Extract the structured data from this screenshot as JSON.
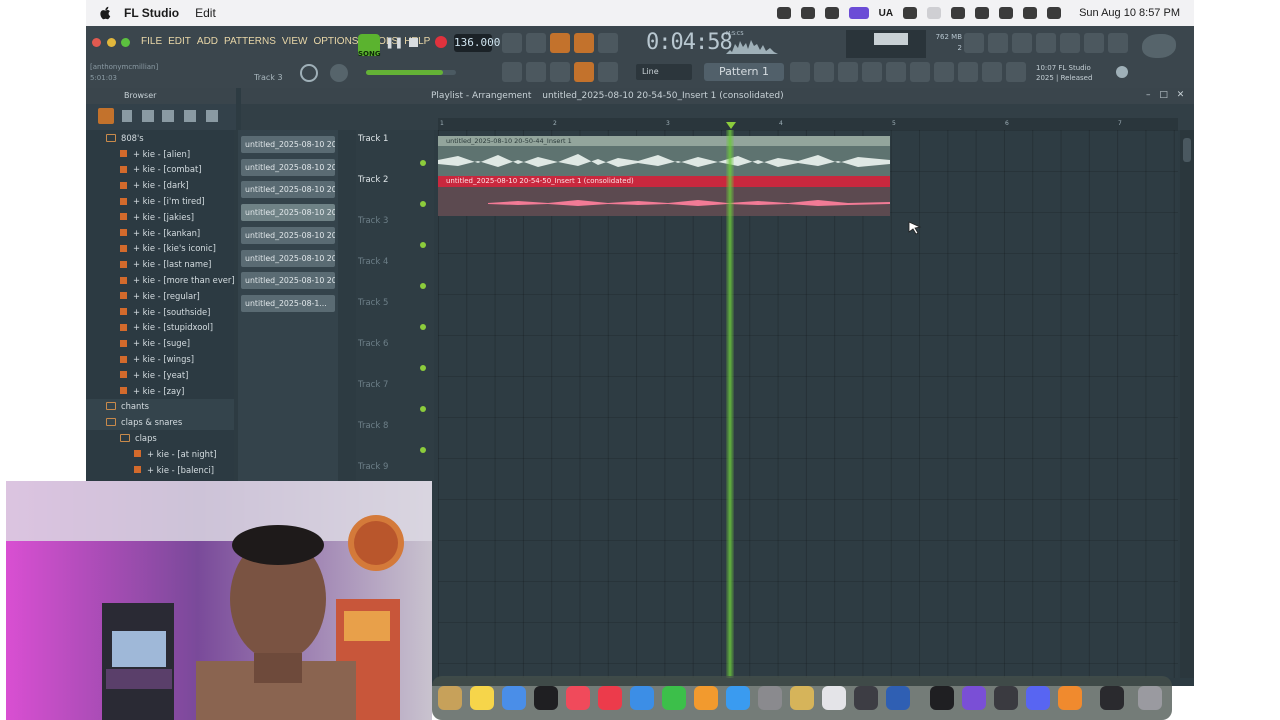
{
  "menubar": {
    "app_name": "FL Studio",
    "menu_edit": "Edit",
    "ua": "UA",
    "clock": "Sun Aug 10  8:57 PM"
  },
  "fl": {
    "menus": [
      "FILE",
      "EDIT",
      "ADD",
      "PATTERNS",
      "VIEW",
      "OPTIONS",
      "TOOLS",
      "HELP"
    ],
    "song_label": "SONG",
    "tempo": "136.000",
    "time": "0:04:58",
    "time_label": "M:S:CS",
    "memory": "762 MB",
    "memory_sub": "2",
    "hint_user": "[anthonymcmillian]",
    "hint_time": "5:01:03",
    "hint_track": "Track 3",
    "snap": "Line",
    "pattern": "Pattern 1",
    "release_line1": "10:07  FL Studio",
    "release_line2": "2025 | Released",
    "master_volume": 0.86
  },
  "browser": {
    "title": "Browser",
    "items": [
      {
        "label": "808's",
        "type": "folder",
        "indent": 1
      },
      {
        "label": "+ kie - [alien]",
        "type": "file",
        "indent": 2
      },
      {
        "label": "+ kie - [combat]",
        "type": "file",
        "indent": 2
      },
      {
        "label": "+ kie - [dark]",
        "type": "file",
        "indent": 2
      },
      {
        "label": "+ kie - [i'm tired]",
        "type": "file",
        "indent": 2
      },
      {
        "label": "+ kie - [jakies]",
        "type": "file",
        "indent": 2
      },
      {
        "label": "+ kie - [kankan]",
        "type": "file",
        "indent": 2
      },
      {
        "label": "+ kie - [kie's iconic]",
        "type": "file",
        "indent": 2
      },
      {
        "label": "+ kie - [last name]",
        "type": "file",
        "indent": 2
      },
      {
        "label": "+ kie - [more than ever]",
        "type": "file",
        "indent": 2
      },
      {
        "label": "+ kie - [regular]",
        "type": "file",
        "indent": 2
      },
      {
        "label": "+ kie - [southside]",
        "type": "file",
        "indent": 2
      },
      {
        "label": "+ kie - [stupidxool]",
        "type": "file",
        "indent": 2
      },
      {
        "label": "+ kie - [suge]",
        "type": "file",
        "indent": 2
      },
      {
        "label": "+ kie - [wings]",
        "type": "file",
        "indent": 2
      },
      {
        "label": "+ kie - [yeat]",
        "type": "file",
        "indent": 2
      },
      {
        "label": "+ kie - [zay]",
        "type": "file",
        "indent": 2
      },
      {
        "label": "chants",
        "type": "folder",
        "indent": 1
      },
      {
        "label": "claps & snares",
        "type": "folder",
        "indent": 1
      },
      {
        "label": "claps",
        "type": "folder",
        "indent": 2
      },
      {
        "label": "+ kie - [at night]",
        "type": "file",
        "indent": 3
      },
      {
        "label": "+ kie - [balenci]",
        "type": "file",
        "indent": 3
      }
    ]
  },
  "picker": {
    "items": [
      "untitled_2025-08-10 20...",
      "untitled_2025-08-10 20...",
      "untitled_2025-08-10 20...",
      "untitled_2025-08-10 20...",
      "untitled_2025-08-10 20...",
      "untitled_2025-08-10 20...",
      "untitled_2025-08-10 20...",
      "untitled_2025-08-1..."
    ]
  },
  "playlist": {
    "title": "Playlist - Arrangement",
    "breadcrumb": "untitled_2025-08-10 20-54-50_Insert 1 (consolidated)",
    "ruler": [
      "1",
      "2",
      "3",
      "4",
      "5",
      "6",
      "7"
    ],
    "tracks": [
      "Track 1",
      "Track 2",
      "Track 3",
      "Track 4",
      "Track 5",
      "Track 6",
      "Track 7",
      "Track 8",
      "Track 9"
    ],
    "clip1": "untitled_2025-08-10 20-50-44_Insert 1",
    "clip2": "untitled_2025-08-10 20-54-50_Insert 1 (consolidated)"
  },
  "colors": {
    "menubar": "#f2f2f4",
    "toolbar": "#3b464d",
    "accent_green": "#5bb32f",
    "record_red": "#e0323d",
    "clip2_red": "#c9283e",
    "clip1_green": "#93a59c",
    "playhead": "#6cc83c"
  }
}
